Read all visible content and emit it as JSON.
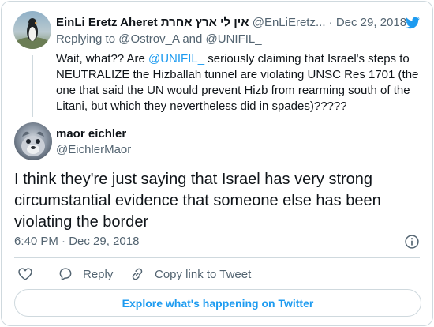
{
  "parent_tweet": {
    "display_name": "EinLi Eretz Aheret אין לי ארץ אחרת",
    "handle": "@EnLiEretz...",
    "separator": "·",
    "date": "Dec 29, 2018",
    "replying_prefix": "Replying to",
    "replying_to_1": "@Ostrov_A",
    "replying_and": "and",
    "replying_to_2": "@UNIFIL_",
    "text_before": "Wait, what?? Are ",
    "text_mention": "@UNIFIL_",
    "text_after": " seriously claiming that Israel's steps to NEUTRALIZE the Hizballah tunnel are violating UNSC Res 1701 (the one that said the UN would prevent Hizb from rearming south of the Litani, but which they nevertheless did in spades)?????"
  },
  "main_tweet": {
    "display_name": "maor eichler",
    "handle": "@EichlerMaor",
    "text": "I think they're just saying that Israel has very strong circumstantial evidence that someone else has been violating the border",
    "time": "6:40 PM",
    "separator": "·",
    "date": "Dec 29, 2018"
  },
  "actions": {
    "reply_label": "Reply",
    "copy_link_label": "Copy link to Tweet"
  },
  "explore_label": "Explore what's happening on Twitter",
  "colors": {
    "accent": "#1d9bf0",
    "secondary_text": "#536471",
    "border": "#cfd9de"
  },
  "icons": [
    "twitter-bird-icon",
    "info-icon",
    "heart-icon",
    "reply-icon",
    "link-icon"
  ]
}
